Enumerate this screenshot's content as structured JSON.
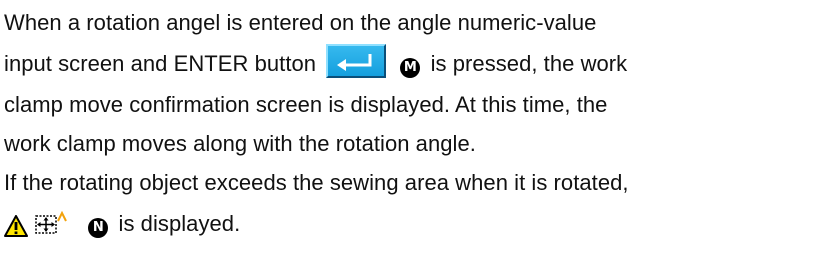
{
  "paragraph": {
    "line1": "When a rotation angel is entered on the angle numeric-value",
    "line2_a": "input screen and ENTER button",
    "marker_m": "M",
    "line2_b": "is pressed, the work",
    "line3": "clamp move confirmation screen is displayed. At this time, the",
    "line4": "work clamp moves along with the rotation angle.",
    "line5": "If the rotating object exceeds the sewing area when it is rotated,",
    "marker_n": "N",
    "line6_b": "is displayed."
  },
  "icons": {
    "enter_button": "enter-return-arrow-icon",
    "warning": "warning-triangle-icon",
    "sewing_area": "sewing-area-exceeded-icon"
  },
  "colors": {
    "enter_button_bg": "#1ea9e8",
    "warning_yellow": "#ffe600"
  }
}
